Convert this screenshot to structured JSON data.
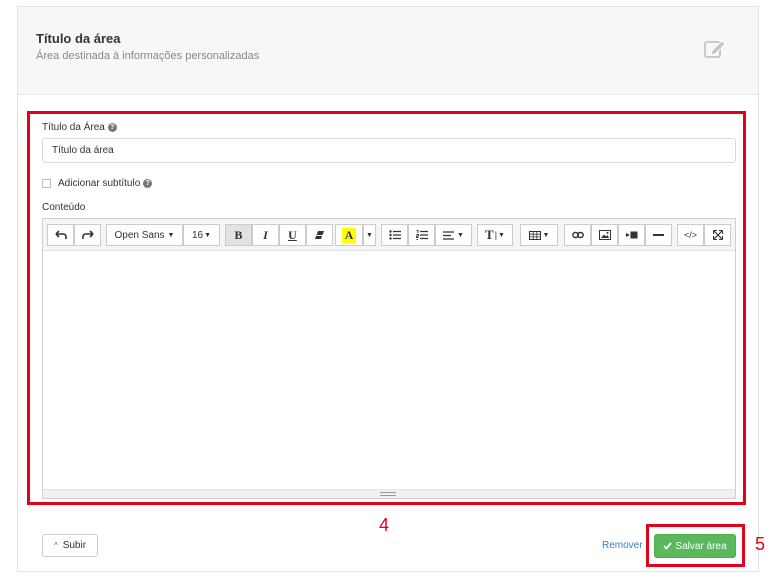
{
  "header": {
    "title": "Título da área",
    "subtitle": "Área destinada à informações personalizadas",
    "edit_icon": "edit-icon"
  },
  "form": {
    "title_label": "Título da Área",
    "title_value": "Título da área",
    "subtitle_checkbox_label": "Adicionar subtítulo",
    "subtitle_checked": false,
    "content_label": "Conteúdo"
  },
  "editor": {
    "font_family": "Open Sans",
    "font_size": "16",
    "bold": "B",
    "italic": "I",
    "underline": "U",
    "highlight": "A",
    "text_style": "T",
    "code_view": "</>",
    "icons": [
      "undo-icon",
      "redo-icon",
      "eraser-icon",
      "unordered-list-icon",
      "ordered-list-icon",
      "align-icon",
      "table-icon",
      "link-icon",
      "picture-icon",
      "video-icon",
      "horizontal-rule-icon",
      "fullscreen-icon"
    ]
  },
  "footer": {
    "up_label": "Subir",
    "remove_label": "Remover",
    "save_label": "Salvar área"
  },
  "annotations": {
    "step_form": "4",
    "step_save": "5",
    "highlight_color": "#e2001a"
  },
  "colors": {
    "save_green": "#5cb85c",
    "link_blue": "#3b7dbf",
    "highlight_yellow": "#ffff00"
  }
}
